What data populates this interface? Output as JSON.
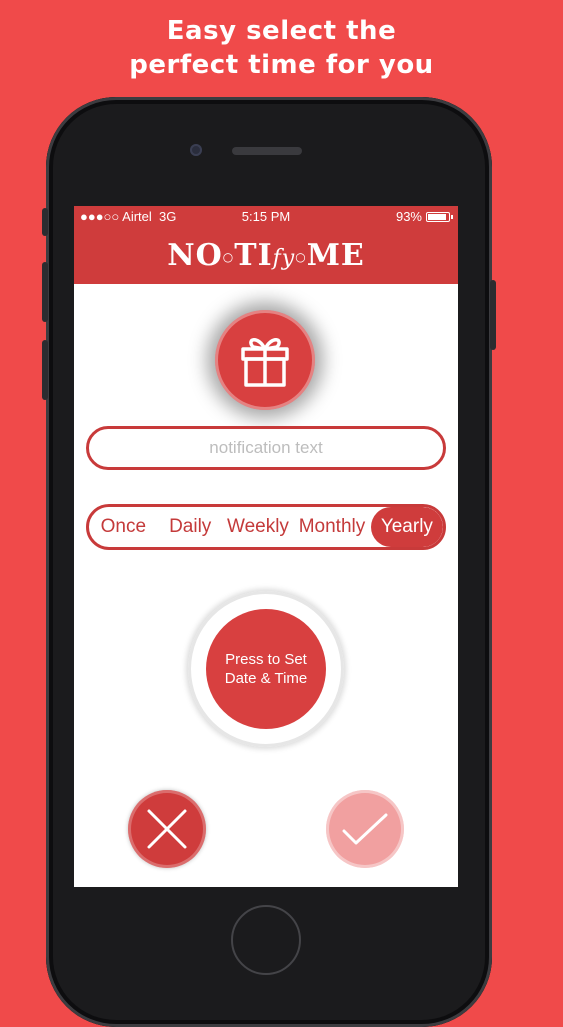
{
  "headline": {
    "line1": "Easy select the",
    "line2": "perfect time for you"
  },
  "status_bar": {
    "carrier": "●●●○○ Airtel",
    "network": "3G",
    "time": "5:15 PM",
    "battery_percent": "93%",
    "battery_level": 0.93
  },
  "app": {
    "logo_part1": "NO",
    "logo_part2": "TI",
    "logo_part3": "fy",
    "logo_part4": "ME"
  },
  "notification_input": {
    "value": "",
    "placeholder": "notification text"
  },
  "repeat_options": [
    {
      "label": "Once",
      "selected": false
    },
    {
      "label": "Daily",
      "selected": false
    },
    {
      "label": "Weekly",
      "selected": false
    },
    {
      "label": "Monthly",
      "selected": false
    },
    {
      "label": "Yearly",
      "selected": true
    }
  ],
  "set_time_button": {
    "line1": "Press to Set",
    "line2": "Date & Time"
  },
  "icons": {
    "gift": "gift-icon",
    "cancel": "close-icon",
    "confirm": "checkmark-icon"
  },
  "colors": {
    "background": "#f04a4a",
    "accent": "#cf3c3c",
    "confirm_disabled": "#f1a0a0",
    "text_white": "#ffffff"
  }
}
